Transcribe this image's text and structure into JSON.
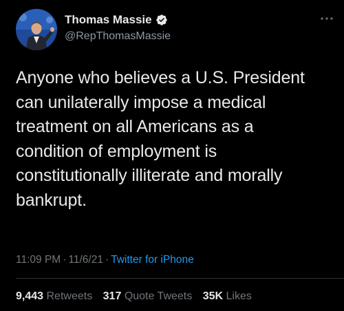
{
  "author": {
    "display_name": "Thomas Massie",
    "handle": "@RepThomasMassie",
    "verified": true,
    "avatar_icon": "avatar-photo"
  },
  "tweet": {
    "text": "Anyone who believes a U.S. President\ncan unilaterally impose a medical\ntreatment on all Americans as a\ncondition of employment is\nconstitutionally illiterate and morally\nbankrupt."
  },
  "meta": {
    "time": "11:09 PM",
    "separator": "·",
    "date": "11/6/21",
    "source": "Twitter for iPhone"
  },
  "stats": {
    "retweets_count": "9,443",
    "retweets_label": "Retweets",
    "quotes_count": "317",
    "quotes_label": "Quote Tweets",
    "likes_count": "35K",
    "likes_label": "Likes"
  },
  "colors": {
    "background": "#000000",
    "text": "#e7e9ea",
    "muted": "#71767b",
    "accent": "#1d9bf0"
  },
  "icons": {
    "verified": "verified-badge-icon",
    "more": "more-options-icon"
  }
}
